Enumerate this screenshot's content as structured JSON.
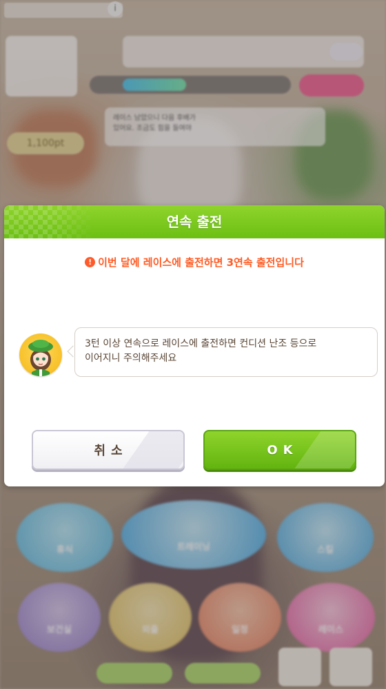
{
  "dialog": {
    "title": "연속 출전",
    "warning_icon": "!",
    "warning": "이번 달에 레이스에 출전하면 3연속 출전입니다",
    "message_line1": "3턴 이상 연속으로 레이스에 출전하면 컨디션 난조 등으로",
    "message_line2": "이어지니 주의해주세요",
    "cancel_label": "취소",
    "ok_label": "OK"
  },
  "background": {
    "top_info_icon": "i",
    "bubble_text_line1": "레이스 남았으니 다음 후배가",
    "bubble_text_line2": "있어요. 조금도 힘을 들여야",
    "points": "1,100pt",
    "menu": [
      "휴식",
      "트레이닝",
      "스킬",
      "보건실",
      "외출",
      "일정",
      "레이스"
    ]
  },
  "colors": {
    "header_green": "#7ac81e",
    "warning_orange": "#ff5a22",
    "text_brown": "#5a4636"
  }
}
